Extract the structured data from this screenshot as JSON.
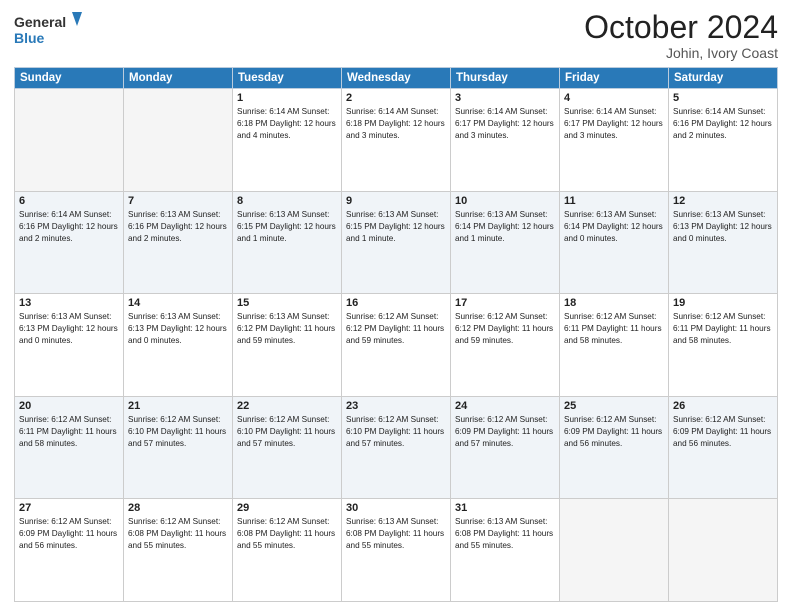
{
  "logo": {
    "line1": "General",
    "line2": "Blue"
  },
  "title": "October 2024",
  "location": "Johin, Ivory Coast",
  "days_header": [
    "Sunday",
    "Monday",
    "Tuesday",
    "Wednesday",
    "Thursday",
    "Friday",
    "Saturday"
  ],
  "weeks": [
    [
      {
        "day": "",
        "info": ""
      },
      {
        "day": "",
        "info": ""
      },
      {
        "day": "1",
        "info": "Sunrise: 6:14 AM\nSunset: 6:18 PM\nDaylight: 12 hours\nand 4 minutes."
      },
      {
        "day": "2",
        "info": "Sunrise: 6:14 AM\nSunset: 6:18 PM\nDaylight: 12 hours\nand 3 minutes."
      },
      {
        "day": "3",
        "info": "Sunrise: 6:14 AM\nSunset: 6:17 PM\nDaylight: 12 hours\nand 3 minutes."
      },
      {
        "day": "4",
        "info": "Sunrise: 6:14 AM\nSunset: 6:17 PM\nDaylight: 12 hours\nand 3 minutes."
      },
      {
        "day": "5",
        "info": "Sunrise: 6:14 AM\nSunset: 6:16 PM\nDaylight: 12 hours\nand 2 minutes."
      }
    ],
    [
      {
        "day": "6",
        "info": "Sunrise: 6:14 AM\nSunset: 6:16 PM\nDaylight: 12 hours\nand 2 minutes."
      },
      {
        "day": "7",
        "info": "Sunrise: 6:13 AM\nSunset: 6:16 PM\nDaylight: 12 hours\nand 2 minutes."
      },
      {
        "day": "8",
        "info": "Sunrise: 6:13 AM\nSunset: 6:15 PM\nDaylight: 12 hours\nand 1 minute."
      },
      {
        "day": "9",
        "info": "Sunrise: 6:13 AM\nSunset: 6:15 PM\nDaylight: 12 hours\nand 1 minute."
      },
      {
        "day": "10",
        "info": "Sunrise: 6:13 AM\nSunset: 6:14 PM\nDaylight: 12 hours\nand 1 minute."
      },
      {
        "day": "11",
        "info": "Sunrise: 6:13 AM\nSunset: 6:14 PM\nDaylight: 12 hours\nand 0 minutes."
      },
      {
        "day": "12",
        "info": "Sunrise: 6:13 AM\nSunset: 6:13 PM\nDaylight: 12 hours\nand 0 minutes."
      }
    ],
    [
      {
        "day": "13",
        "info": "Sunrise: 6:13 AM\nSunset: 6:13 PM\nDaylight: 12 hours\nand 0 minutes."
      },
      {
        "day": "14",
        "info": "Sunrise: 6:13 AM\nSunset: 6:13 PM\nDaylight: 12 hours\nand 0 minutes."
      },
      {
        "day": "15",
        "info": "Sunrise: 6:13 AM\nSunset: 6:12 PM\nDaylight: 11 hours\nand 59 minutes."
      },
      {
        "day": "16",
        "info": "Sunrise: 6:12 AM\nSunset: 6:12 PM\nDaylight: 11 hours\nand 59 minutes."
      },
      {
        "day": "17",
        "info": "Sunrise: 6:12 AM\nSunset: 6:12 PM\nDaylight: 11 hours\nand 59 minutes."
      },
      {
        "day": "18",
        "info": "Sunrise: 6:12 AM\nSunset: 6:11 PM\nDaylight: 11 hours\nand 58 minutes."
      },
      {
        "day": "19",
        "info": "Sunrise: 6:12 AM\nSunset: 6:11 PM\nDaylight: 11 hours\nand 58 minutes."
      }
    ],
    [
      {
        "day": "20",
        "info": "Sunrise: 6:12 AM\nSunset: 6:11 PM\nDaylight: 11 hours\nand 58 minutes."
      },
      {
        "day": "21",
        "info": "Sunrise: 6:12 AM\nSunset: 6:10 PM\nDaylight: 11 hours\nand 57 minutes."
      },
      {
        "day": "22",
        "info": "Sunrise: 6:12 AM\nSunset: 6:10 PM\nDaylight: 11 hours\nand 57 minutes."
      },
      {
        "day": "23",
        "info": "Sunrise: 6:12 AM\nSunset: 6:10 PM\nDaylight: 11 hours\nand 57 minutes."
      },
      {
        "day": "24",
        "info": "Sunrise: 6:12 AM\nSunset: 6:09 PM\nDaylight: 11 hours\nand 57 minutes."
      },
      {
        "day": "25",
        "info": "Sunrise: 6:12 AM\nSunset: 6:09 PM\nDaylight: 11 hours\nand 56 minutes."
      },
      {
        "day": "26",
        "info": "Sunrise: 6:12 AM\nSunset: 6:09 PM\nDaylight: 11 hours\nand 56 minutes."
      }
    ],
    [
      {
        "day": "27",
        "info": "Sunrise: 6:12 AM\nSunset: 6:09 PM\nDaylight: 11 hours\nand 56 minutes."
      },
      {
        "day": "28",
        "info": "Sunrise: 6:12 AM\nSunset: 6:08 PM\nDaylight: 11 hours\nand 55 minutes."
      },
      {
        "day": "29",
        "info": "Sunrise: 6:12 AM\nSunset: 6:08 PM\nDaylight: 11 hours\nand 55 minutes."
      },
      {
        "day": "30",
        "info": "Sunrise: 6:13 AM\nSunset: 6:08 PM\nDaylight: 11 hours\nand 55 minutes."
      },
      {
        "day": "31",
        "info": "Sunrise: 6:13 AM\nSunset: 6:08 PM\nDaylight: 11 hours\nand 55 minutes."
      },
      {
        "day": "",
        "info": ""
      },
      {
        "day": "",
        "info": ""
      }
    ]
  ]
}
